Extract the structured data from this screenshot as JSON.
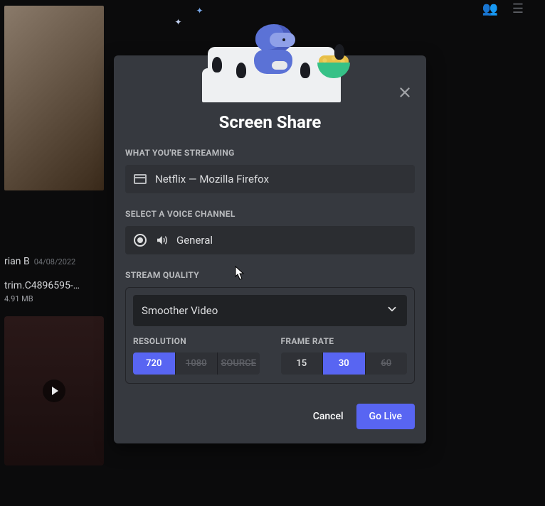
{
  "background": {
    "user_name": "rian B",
    "date": "04/08/2022",
    "file_name": "trim.C4896595-…",
    "file_size": "4.91 MB"
  },
  "modal": {
    "title": "Screen Share",
    "streaming_label": "WHAT YOU'RE STREAMING",
    "streaming_window": "Netflix — Mozilla Firefox",
    "channel_label": "SELECT A VOICE CHANNEL",
    "channel_name": "General",
    "quality_label": "STREAM QUALITY",
    "quality_preset": "Smoother Video",
    "resolution_label": "RESOLUTION",
    "resolution_options": [
      {
        "label": "720",
        "state": "active"
      },
      {
        "label": "1080",
        "state": "disabled"
      },
      {
        "label": "SOURCE",
        "state": "disabled"
      }
    ],
    "framerate_label": "FRAME RATE",
    "framerate_options": [
      {
        "label": "15",
        "state": "normal"
      },
      {
        "label": "30",
        "state": "active"
      },
      {
        "label": "60",
        "state": "disabled"
      }
    ],
    "cancel_label": "Cancel",
    "go_live_label": "Go Live"
  }
}
